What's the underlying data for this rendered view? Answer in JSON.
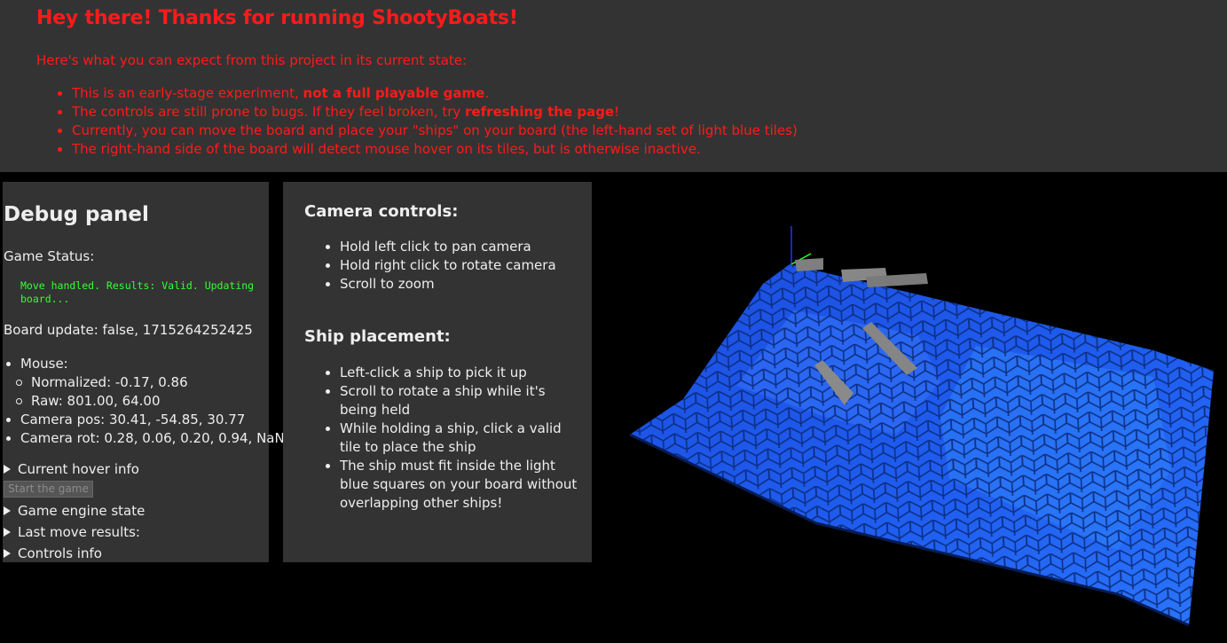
{
  "banner": {
    "title": "Hey there! Thanks for running ShootyBoats!",
    "intro": "Here's what you can expect from this project in its current state:",
    "bullets": [
      {
        "pre": "This is an early-stage experiment, ",
        "bold": "not a full playable game",
        "post": "."
      },
      {
        "pre": "The controls are still prone to bugs. If they feel broken, try ",
        "bold": "refreshing the page",
        "post": "!"
      },
      {
        "pre": "Currently, you can move the board and place your \"ships\" on your board (the left-hand set of light blue tiles)",
        "bold": "",
        "post": ""
      },
      {
        "pre": "The right-hand side of the board will detect mouse hover on its tiles, but is otherwise inactive.",
        "bold": "",
        "post": ""
      }
    ],
    "text_color": "#ff1a1a",
    "background": "#333333"
  },
  "debug": {
    "title": "Debug panel",
    "status_label": "Game Status:",
    "status_message": "Move handled. Results: Valid. Updating board...",
    "status_color": "#33ff33",
    "board_update": "Board update: false, 1715264252425",
    "mouse_label": "Mouse:",
    "normalized": "Normalized: -0.17, 0.86",
    "raw": "Raw: 801.00, 64.00",
    "camera_pos": "Camera pos: 30.41, -54.85, 30.77",
    "camera_rot": "Camera rot: 0.28, 0.06, 0.20, 0.94, NaN",
    "hover_info": "Current hover info",
    "start_button": "Start the game",
    "engine_state": "Game engine state",
    "last_move": "Last move results:",
    "controls_info": "Controls info"
  },
  "controls": {
    "camera_heading": "Camera controls:",
    "camera_items": [
      "Hold left click to pan camera",
      "Hold right click to rotate camera",
      "Scroll to zoom"
    ],
    "ship_heading": "Ship placement:",
    "ship_items": [
      "Left-click a ship to pick it up",
      "Scroll to rotate a ship while it's being held",
      "While holding a ship, click a valid tile to place the ship",
      "The ship must fit inside the light blue squares on your board without overlapping other ships!"
    ]
  },
  "scene": {
    "tile_color_dark": "#1a55e8",
    "tile_color_light": "#2f7cf6",
    "ship_color": "#808080",
    "background": "#000000"
  }
}
